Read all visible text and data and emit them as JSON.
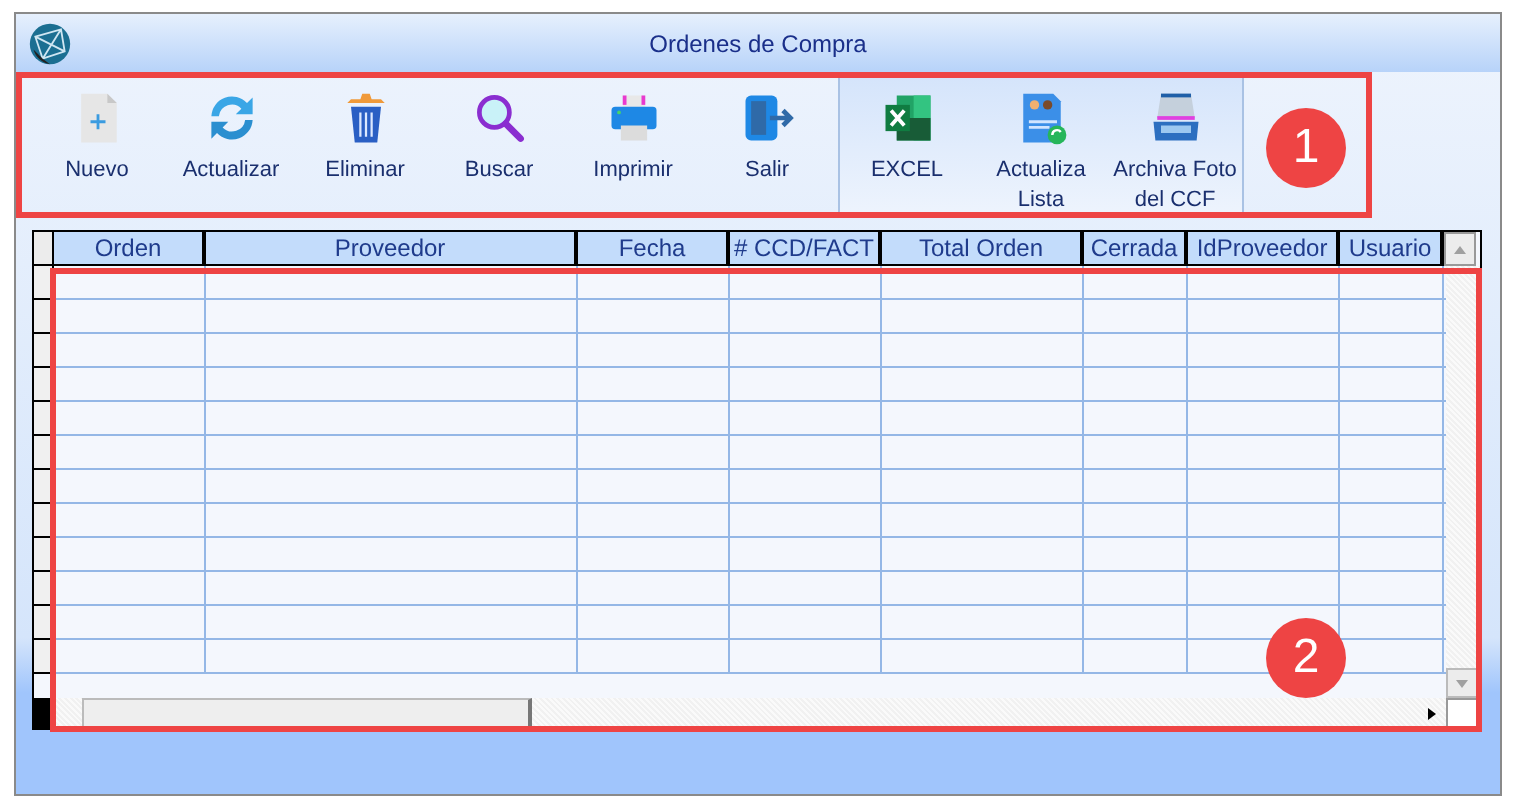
{
  "window": {
    "title": "Ordenes de Compra"
  },
  "toolbar": {
    "groups": [
      {
        "buttons": [
          {
            "label": "Nuevo"
          },
          {
            "label": "Actualizar"
          },
          {
            "label": "Eliminar"
          },
          {
            "label": "Buscar"
          },
          {
            "label": "Imprimir"
          },
          {
            "label": "Salir"
          }
        ]
      },
      {
        "buttons": [
          {
            "label": "EXCEL"
          },
          {
            "label": "Actualiza Lista"
          },
          {
            "label": "Archiva Foto del CCF"
          }
        ]
      }
    ]
  },
  "table": {
    "columns": [
      "Orden",
      "Proveedor",
      "Fecha",
      "# CCD/FACT",
      "Total Orden",
      "Cerrada",
      "IdProveedor",
      "Usuario"
    ]
  },
  "annotations": [
    {
      "label": "1"
    },
    {
      "label": "2"
    }
  ]
}
